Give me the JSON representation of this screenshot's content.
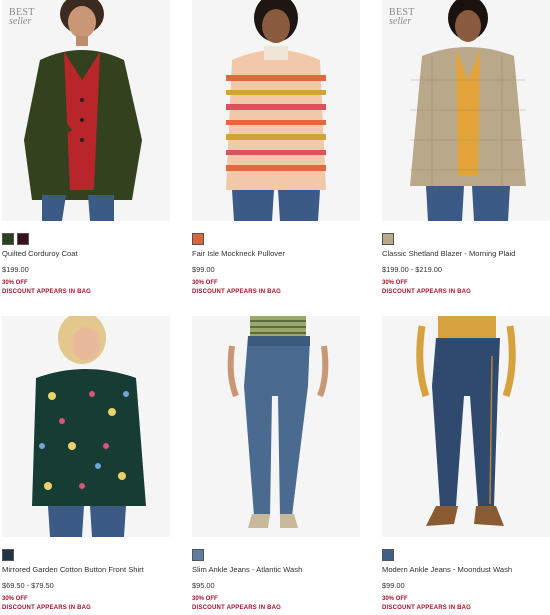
{
  "products": [
    {
      "badge_line1": "BEST",
      "badge_line2": "seller",
      "name": "Quilted Corduroy Coat",
      "price": "$199.00",
      "promo": "30% OFF",
      "promo_note": "DISCOUNT APPEARS IN BAG",
      "swatches": [
        "#2f4021",
        "#3b1020"
      ],
      "image": "model-green-coat"
    },
    {
      "badge_line1": "",
      "badge_line2": "",
      "name": "Fair Isle Mockneck Pullover",
      "price": "$99.00",
      "promo": "30% OFF",
      "promo_note": "DISCOUNT APPEARS IN BAG",
      "swatches": [
        "#d9653a"
      ],
      "image": "model-fair-isle-sweater"
    },
    {
      "badge_line1": "BEST",
      "badge_line2": "seller",
      "name": "Classic Shetland Blazer - Morning Plaid",
      "price": "$199.00 - $219.00",
      "promo": "30% OFF",
      "promo_note": "DISCOUNT APPEARS IN BAG",
      "swatches": [
        "#b9a98a"
      ],
      "image": "model-plaid-blazer"
    },
    {
      "badge_line1": "",
      "badge_line2": "",
      "name": "Mirrored Garden Cotton Button Front Shirt",
      "price": "$69.50 - $79.50",
      "promo": "30% OFF",
      "promo_note": "DISCOUNT APPEARS IN BAG",
      "swatches": [
        "#223344"
      ],
      "image": "model-floral-shirt"
    },
    {
      "badge_line1": "",
      "badge_line2": "",
      "name": "Slim Ankle Jeans - Atlantic Wash",
      "price": "$95.00",
      "promo": "30% OFF",
      "promo_note": "DISCOUNT APPEARS IN BAG",
      "swatches": [
        "#5d7d9f"
      ],
      "image": "model-slim-jeans"
    },
    {
      "badge_line1": "",
      "badge_line2": "",
      "name": "Modern Ankle Jeans - Moondust Wash",
      "price": "$99.00",
      "promo": "30% OFF",
      "promo_note": "DISCOUNT APPEARS IN BAG",
      "swatches": [
        "#3f5f86"
      ],
      "image": "model-modern-jeans"
    }
  ],
  "colors": {
    "promo": "#a3122a",
    "text": "#333333",
    "badge": "#8a8a8a"
  }
}
